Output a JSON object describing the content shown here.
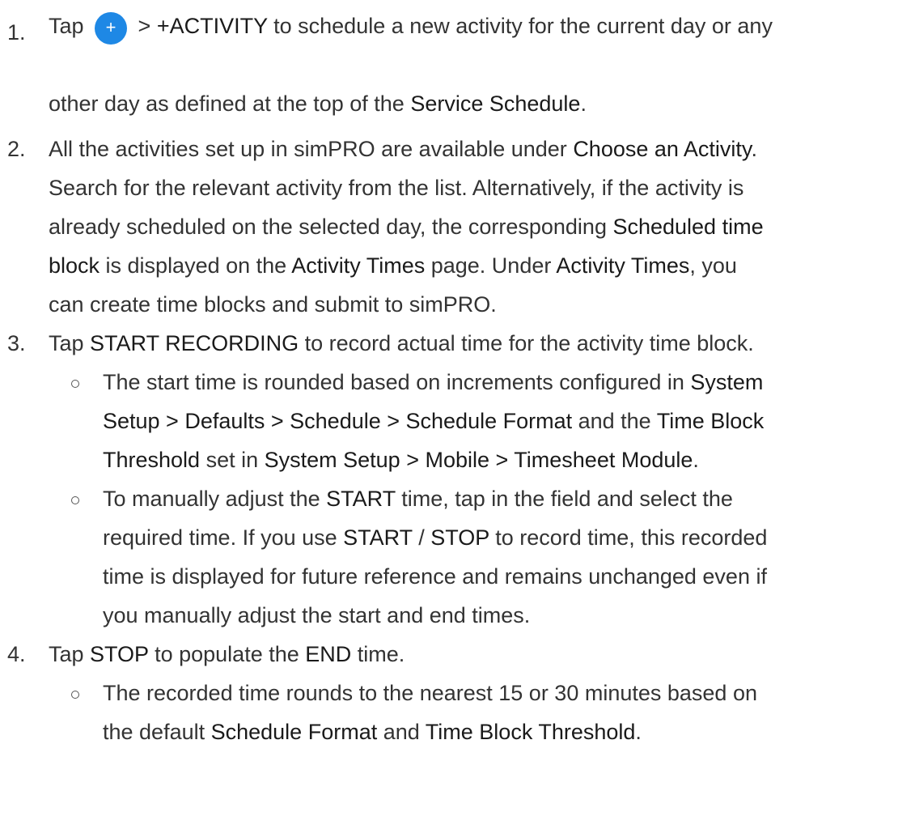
{
  "steps": [
    {
      "number": "1.",
      "lines": [
        [
          {
            "t": "Tap "
          },
          {
            "icon": "plus-button"
          },
          {
            "t": " > "
          },
          {
            "t": "+ACTIVITY",
            "b": true
          },
          {
            "t": " to schedule a new activity for the current day or any"
          }
        ],
        [],
        [
          {
            "t": "other day as defined at the top of the "
          },
          {
            "t": "Service Schedule",
            "b": true
          },
          {
            "t": "."
          }
        ]
      ]
    },
    {
      "number": "2.",
      "lines": [
        [
          {
            "t": "All the activities set up in simPRO are available under "
          },
          {
            "t": "Choose an Activity",
            "b": true
          },
          {
            "t": "."
          }
        ],
        [
          {
            "t": "Search for the relevant activity from the list. Alternatively, if the activity is"
          }
        ],
        [
          {
            "t": "already scheduled on the selected day, the corresponding "
          },
          {
            "t": "Scheduled time",
            "b": true
          }
        ],
        [
          {
            "t": "block",
            "b": true
          },
          {
            "t": " is displayed on the "
          },
          {
            "t": "Activity Times",
            "b": true
          },
          {
            "t": " page. Under "
          },
          {
            "t": "Activity Times",
            "b": true
          },
          {
            "t": ", you"
          }
        ],
        [
          {
            "t": "can create time blocks and submit to simPRO."
          }
        ]
      ]
    },
    {
      "number": "3.",
      "lines": [
        [
          {
            "t": "Tap "
          },
          {
            "t": "START RECORDING",
            "b": true
          },
          {
            "t": " to record actual time for the activity time block."
          }
        ]
      ],
      "bullets": [
        {
          "lines": [
            [
              {
                "t": "The start time is rounded based on increments configured in "
              },
              {
                "t": "System",
                "b": true
              }
            ],
            [
              {
                "t": "Setup > Defaults > Schedule > Schedule Format",
                "b": true
              },
              {
                "t": " and the "
              },
              {
                "t": "Time Block",
                "b": true
              }
            ],
            [
              {
                "t": "Threshold",
                "b": true
              },
              {
                "t": " set in "
              },
              {
                "t": "System Setup > Mobile > Timesheet Module",
                "b": true
              },
              {
                "t": "."
              }
            ]
          ]
        },
        {
          "lines": [
            [
              {
                "t": "To manually adjust the "
              },
              {
                "t": "START",
                "b": true
              },
              {
                "t": " time, tap in the field and select the"
              }
            ],
            [
              {
                "t": "required time. If you use "
              },
              {
                "t": "START",
                "b": true
              },
              {
                "t": " / "
              },
              {
                "t": "STOP",
                "b": true
              },
              {
                "t": " to record time, this recorded"
              }
            ],
            [
              {
                "t": "time is displayed for future reference and remains unchanged even if"
              }
            ],
            [
              {
                "t": "you manually adjust the start and end times."
              }
            ]
          ]
        }
      ]
    },
    {
      "number": "4.",
      "lines": [
        [
          {
            "t": "Tap "
          },
          {
            "t": "STOP",
            "b": true
          },
          {
            "t": " to populate the "
          },
          {
            "t": "END",
            "b": true
          },
          {
            "t": " time."
          }
        ]
      ],
      "bullets": [
        {
          "lines": [
            [
              {
                "t": "The recorded time rounds to the nearest 15 or 30 minutes based on"
              }
            ],
            [
              {
                "t": "the default "
              },
              {
                "t": "Schedule Format",
                "b": true
              },
              {
                "t": " and "
              },
              {
                "t": "Time Block Threshold",
                "b": true
              },
              {
                "t": "."
              }
            ]
          ]
        }
      ]
    }
  ],
  "icons": {
    "plus-button": {
      "glyph": "+",
      "color": "#1e88e5"
    }
  }
}
